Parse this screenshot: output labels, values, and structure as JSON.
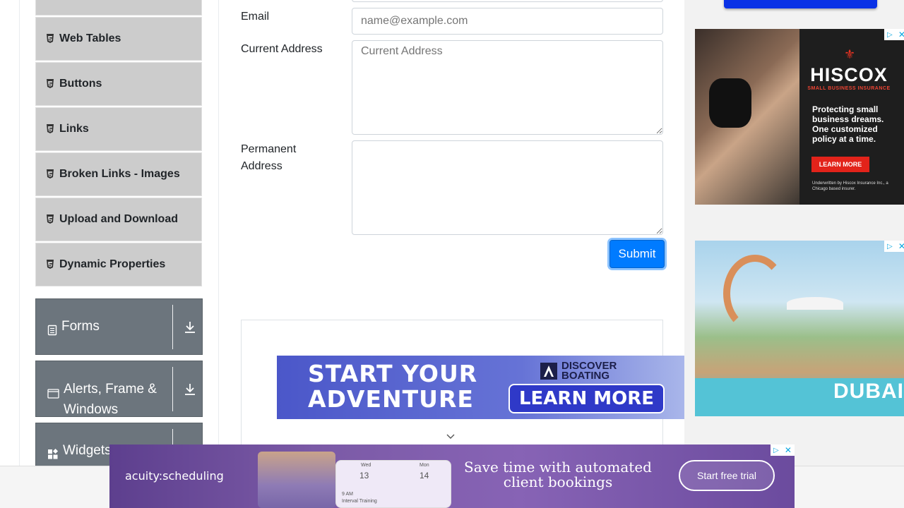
{
  "sidebar": {
    "sub_items": [
      {
        "label": "Web Tables"
      },
      {
        "label": "Buttons"
      },
      {
        "label": "Links"
      },
      {
        "label": "Broken Links - Images"
      },
      {
        "label": "Upload and Download"
      },
      {
        "label": "Dynamic Properties"
      }
    ],
    "groups": [
      {
        "label": "Forms",
        "icon": "clipboard-icon"
      },
      {
        "label": "Alerts, Frame & Windows",
        "icon": "window-icon"
      },
      {
        "label": "Widgets",
        "icon": "widgets-icon"
      }
    ]
  },
  "form": {
    "email_label": "Email",
    "email_placeholder": "name@example.com",
    "current_address_label": "Current Address",
    "current_address_placeholder": "Current Address",
    "permanent_address_label": "Permanent Address",
    "submit_label": "Submit"
  },
  "ads": {
    "boating": {
      "headline_1": "START YOUR",
      "headline_2": "ADVENTURE",
      "brand_1": "DISCOVER",
      "brand_2": "BOATING",
      "cta": "LEARN MORE"
    },
    "hiscox": {
      "brand": "HISCOX",
      "tagline": "SMALL BUSINESS INSURANCE",
      "copy": "Protecting small business dreams. One customized policy at a time.",
      "cta": "LEARN MORE",
      "fine": "Underwritten by Hiscox Insurance Inc., a Chicago based insurer."
    },
    "dubai": {
      "brand": "DUBAI"
    },
    "acuity": {
      "logo": "acuity:scheduling",
      "headline": "Save time with automated client bookings",
      "cta": "Start free trial",
      "cal_day_1": "Wed",
      "cal_num_1": "13",
      "cal_day_2": "Mon",
      "cal_num_2": "14",
      "cal_time": "9 AM",
      "cal_event": "Interval Training"
    }
  },
  "colors": {
    "primary": "#007bff",
    "sidebar_group": "#6c757d",
    "sidebar_item": "#cccccc"
  }
}
